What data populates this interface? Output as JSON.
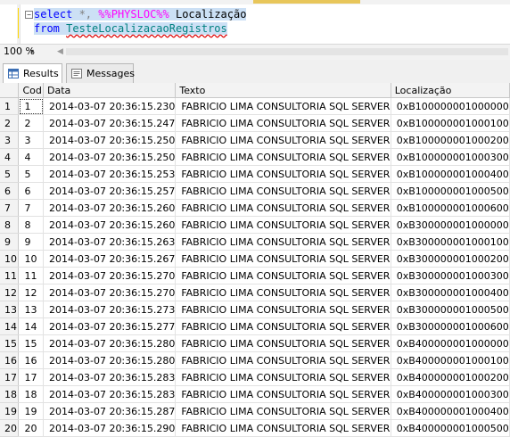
{
  "editor": {
    "line1": {
      "kw": "select",
      "star": " *, ",
      "fn": "%%PHYSLOC%%",
      "alias": " Localização"
    },
    "line2": {
      "kw": "from",
      "table": "TesteLocalizacaoRegistros"
    },
    "collapse_glyph": "−"
  },
  "zoom": {
    "value": "100 %",
    "arrow": "▾"
  },
  "tabs": {
    "results": "Results",
    "messages": "Messages"
  },
  "grid": {
    "columns": [
      "",
      "Cod",
      "Data",
      "Texto",
      "Localização"
    ],
    "rows": [
      [
        "1",
        "1",
        "2014-03-07 20:36:15.230",
        "FABRICIO LIMA CONSULTORIA SQL SERVER",
        "0xB100000001000000"
      ],
      [
        "2",
        "2",
        "2014-03-07 20:36:15.247",
        "FABRICIO LIMA CONSULTORIA SQL SERVER",
        "0xB100000001000100"
      ],
      [
        "3",
        "3",
        "2014-03-07 20:36:15.250",
        "FABRICIO LIMA CONSULTORIA SQL SERVER",
        "0xB100000001000200"
      ],
      [
        "4",
        "4",
        "2014-03-07 20:36:15.250",
        "FABRICIO LIMA CONSULTORIA SQL SERVER",
        "0xB100000001000300"
      ],
      [
        "5",
        "5",
        "2014-03-07 20:36:15.253",
        "FABRICIO LIMA CONSULTORIA SQL SERVER",
        "0xB100000001000400"
      ],
      [
        "6",
        "6",
        "2014-03-07 20:36:15.257",
        "FABRICIO LIMA CONSULTORIA SQL SERVER",
        "0xB100000001000500"
      ],
      [
        "7",
        "7",
        "2014-03-07 20:36:15.260",
        "FABRICIO LIMA CONSULTORIA SQL SERVER",
        "0xB100000001000600"
      ],
      [
        "8",
        "8",
        "2014-03-07 20:36:15.260",
        "FABRICIO LIMA CONSULTORIA SQL SERVER",
        "0xB300000001000000"
      ],
      [
        "9",
        "9",
        "2014-03-07 20:36:15.263",
        "FABRICIO LIMA CONSULTORIA SQL SERVER",
        "0xB300000001000100"
      ],
      [
        "10",
        "10",
        "2014-03-07 20:36:15.267",
        "FABRICIO LIMA CONSULTORIA SQL SERVER",
        "0xB300000001000200"
      ],
      [
        "11",
        "11",
        "2014-03-07 20:36:15.270",
        "FABRICIO LIMA CONSULTORIA SQL SERVER",
        "0xB300000001000300"
      ],
      [
        "12",
        "12",
        "2014-03-07 20:36:15.270",
        "FABRICIO LIMA CONSULTORIA SQL SERVER",
        "0xB300000001000400"
      ],
      [
        "13",
        "13",
        "2014-03-07 20:36:15.273",
        "FABRICIO LIMA CONSULTORIA SQL SERVER",
        "0xB300000001000500"
      ],
      [
        "14",
        "14",
        "2014-03-07 20:36:15.277",
        "FABRICIO LIMA CONSULTORIA SQL SERVER",
        "0xB300000001000600"
      ],
      [
        "15",
        "15",
        "2014-03-07 20:36:15.280",
        "FABRICIO LIMA CONSULTORIA SQL SERVER",
        "0xB400000001000000"
      ],
      [
        "16",
        "16",
        "2014-03-07 20:36:15.280",
        "FABRICIO LIMA CONSULTORIA SQL SERVER",
        "0xB400000001000100"
      ],
      [
        "17",
        "17",
        "2014-03-07 20:36:15.283",
        "FABRICIO LIMA CONSULTORIA SQL SERVER",
        "0xB400000001000200"
      ],
      [
        "18",
        "18",
        "2014-03-07 20:36:15.283",
        "FABRICIO LIMA CONSULTORIA SQL SERVER",
        "0xB400000001000300"
      ],
      [
        "19",
        "19",
        "2014-03-07 20:36:15.287",
        "FABRICIO LIMA CONSULTORIA SQL SERVER",
        "0xB400000001000400"
      ],
      [
        "20",
        "20",
        "2014-03-07 20:36:15.290",
        "FABRICIO LIMA CONSULTORIA SQL SERVER",
        "0xB400000001000500"
      ]
    ]
  },
  "colors": {
    "keyword": "#0000ff",
    "function": "#ff00ff",
    "table": "#008080",
    "selection": "#cce0f5"
  }
}
